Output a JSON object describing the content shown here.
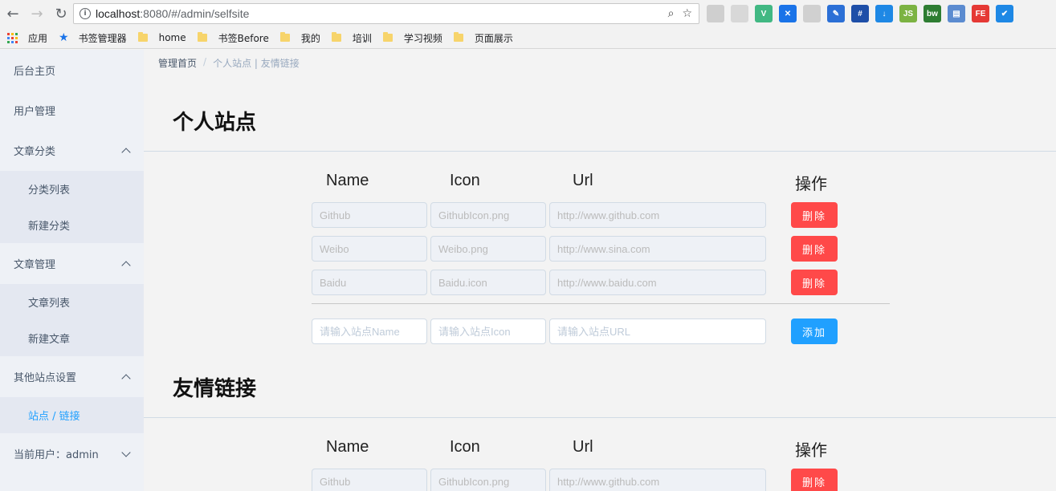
{
  "browser": {
    "url_host": "localhost",
    "url_rest": ":8080/#/admin/selfsite",
    "bookmarks": [
      {
        "label": "应用",
        "type": "apps"
      },
      {
        "label": "书签管理器",
        "type": "star"
      },
      {
        "label": "home",
        "type": "folder"
      },
      {
        "label": "书签Before",
        "type": "folder"
      },
      {
        "label": "我的",
        "type": "folder"
      },
      {
        "label": "培训",
        "type": "folder"
      },
      {
        "label": "学习视频",
        "type": "folder"
      },
      {
        "label": "页面展示",
        "type": "folder"
      }
    ],
    "extensions": [
      {
        "name": "ext-grey-icon",
        "glyph": "",
        "color": "#cfcfcf"
      },
      {
        "name": "ext-grey-circle-icon",
        "glyph": "",
        "color": "#d8d8d8"
      },
      {
        "name": "vue-devtools-icon",
        "glyph": "V",
        "color": "#41b883"
      },
      {
        "name": "ext-blue-icon",
        "glyph": "✕",
        "color": "#1a73e8"
      },
      {
        "name": "ext-grey-leaf-icon",
        "glyph": "",
        "color": "#d0d0d0"
      },
      {
        "name": "color-picker-icon",
        "glyph": "✎",
        "color": "#2b6fd6"
      },
      {
        "name": "grid-ruler-icon",
        "glyph": "#",
        "color": "#1e4fa8"
      },
      {
        "name": "download-icon",
        "glyph": "↓",
        "color": "#1e88e5"
      },
      {
        "name": "nodejs-icon",
        "glyph": "JS",
        "color": "#7cb342"
      },
      {
        "name": "bw-icon",
        "glyph": "bw",
        "color": "#2e7d32"
      },
      {
        "name": "ext-printer-icon",
        "glyph": "▤",
        "color": "#5b8bd0"
      },
      {
        "name": "fe-helper-icon",
        "glyph": "FE",
        "color": "#e53935"
      },
      {
        "name": "pocket-icon",
        "glyph": "✔",
        "color": "#1e88e5"
      }
    ]
  },
  "sidebar": {
    "home": "后台主页",
    "users": "用户管理",
    "category_group": "文章分类",
    "category_list": "分类列表",
    "category_new": "新建分类",
    "article_group": "文章管理",
    "article_list": "文章列表",
    "article_new": "新建文章",
    "site_group": "其他站点设置",
    "site_links": "站点 / 链接",
    "current_user": "当前用户：admin"
  },
  "breadcrumb": {
    "home": "管理首页",
    "separator": "/",
    "current": "个人站点 | 友情链接"
  },
  "sites": {
    "title": "个人站点",
    "headers": {
      "name": "Name",
      "icon": "Icon",
      "url": "Url",
      "action": "操作"
    },
    "rows": [
      {
        "name": "Github",
        "icon": "GithubIcon.png",
        "url": "http://www.github.com",
        "delete": "删除"
      },
      {
        "name": "Weibo",
        "icon": "Weibo.png",
        "url": "http://www.sina.com",
        "delete": "删除"
      },
      {
        "name": "Baidu",
        "icon": "Baidu.icon",
        "url": "http://www.baidu.com",
        "delete": "删除"
      }
    ],
    "new_row": {
      "name_placeholder": "请输入站点Name",
      "icon_placeholder": "请输入站点Icon",
      "url_placeholder": "请输入站点URL",
      "add": "添加"
    }
  },
  "links": {
    "title": "友情链接",
    "headers": {
      "name": "Name",
      "icon": "Icon",
      "url": "Url",
      "action": "操作"
    },
    "rows": [
      {
        "name": "Github",
        "icon": "GithubIcon.png",
        "url": "http://www.github.com",
        "delete": "删除"
      }
    ]
  },
  "colors": {
    "danger": "#ff4949",
    "primary": "#20a0ff",
    "sidebar_bg": "#eef1f6",
    "active": "#20a0ff"
  }
}
